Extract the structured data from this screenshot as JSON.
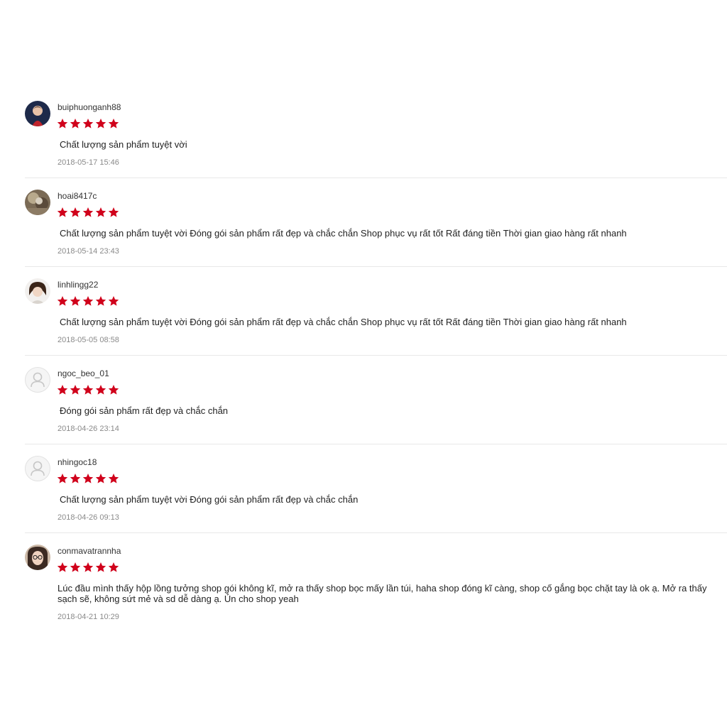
{
  "colors": {
    "star": "#d0011b",
    "text": "#222222",
    "meta": "#8a8a8a",
    "divider": "#e8e8e8"
  },
  "reviews": [
    {
      "username": "buiphuonganh88",
      "rating": 5,
      "comment": "Chất lượng sản phẩm tuyệt vời",
      "date": "2018-05-17 15:46",
      "avatar": "photo"
    },
    {
      "username": "hoai8417c",
      "rating": 5,
      "comment": "Chất lượng sản phẩm tuyệt vời Đóng gói sản phẩm rất đẹp và chắc chắn Shop phục vụ rất tốt Rất đáng tiền Thời gian giao hàng rất nhanh",
      "date": "2018-05-14 23:43",
      "avatar": "photo"
    },
    {
      "username": "linhlingg22",
      "rating": 5,
      "comment": "Chất lượng sản phẩm tuyệt vời Đóng gói sản phẩm rất đẹp và chắc chắn Shop phục vụ rất tốt Rất đáng tiền Thời gian giao hàng rất nhanh",
      "date": "2018-05-05 08:58",
      "avatar": "photo"
    },
    {
      "username": "ngoc_beo_01",
      "rating": 5,
      "comment": "Đóng gói sản phẩm rất đẹp và chắc chắn",
      "date": "2018-04-26 23:14",
      "avatar": "default-user-icon"
    },
    {
      "username": "nhingoc18",
      "rating": 5,
      "comment": "Chất lượng sản phẩm tuyệt vời Đóng gói sản phẩm rất đẹp và chắc chắn",
      "date": "2018-04-26 09:13",
      "avatar": "default-user-icon"
    },
    {
      "username": "conmavatrannha",
      "rating": 5,
      "comment": "Lúc đầu mình thấy hộp lồng tưởng shop gói không kĩ, mở ra thấy shop bọc mấy lần túi, haha shop đóng kĩ càng, shop cố gắng bọc chặt tay là ok ạ. Mở ra thấy sạch sẽ, không sứt mẻ và sd dễ dàng ạ. Ủn cho shop yeah",
      "date": "2018-04-21 10:29",
      "avatar": "photo"
    }
  ]
}
